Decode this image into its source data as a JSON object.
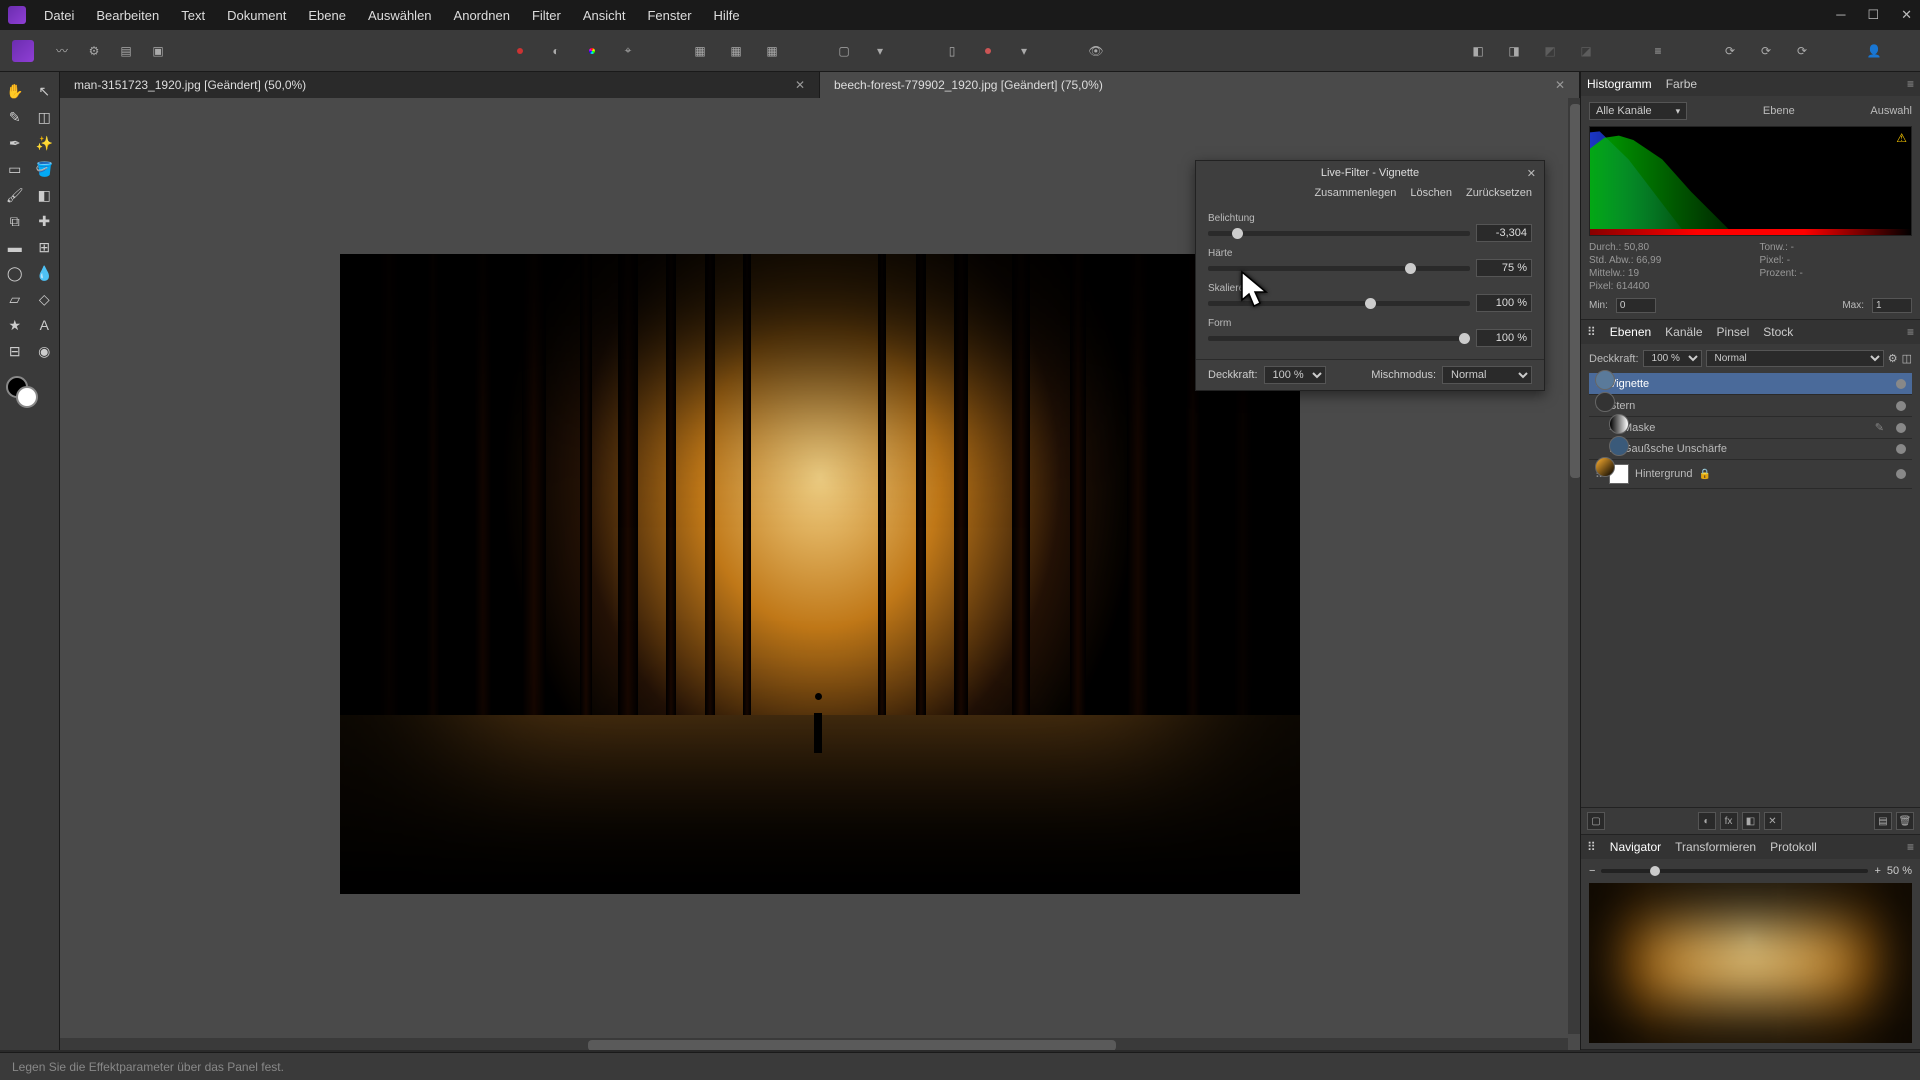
{
  "menubar": [
    "Datei",
    "Bearbeiten",
    "Text",
    "Dokument",
    "Ebene",
    "Auswählen",
    "Anordnen",
    "Filter",
    "Ansicht",
    "Fenster",
    "Hilfe"
  ],
  "tabs": [
    {
      "label": "man-3151723_1920.jpg [Geändert] (50,0%)",
      "active": false
    },
    {
      "label": "beech-forest-779902_1920.jpg [Geändert] (75,0%)",
      "active": true
    }
  ],
  "dialog": {
    "title": "Live-Filter - Vignette",
    "links": [
      "Zusammenlegen",
      "Löschen",
      "Zurücksetzen"
    ],
    "params": [
      {
        "label": "Belichtung",
        "value": "-3,304",
        "pos": 9
      },
      {
        "label": "Härte",
        "value": "75 %",
        "pos": 75
      },
      {
        "label": "Skalieren",
        "value": "100 %",
        "pos": 60
      },
      {
        "label": "Form",
        "value": "100 %",
        "pos": 100
      }
    ],
    "opacity_label": "Deckkraft:",
    "opacity": "100 %",
    "blend_label": "Mischmodus:",
    "blend": "Normal"
  },
  "histogram_panel": {
    "tabs": [
      "Histogramm",
      "Farbe"
    ],
    "channels": "Alle Kanäle",
    "chips": [
      "Ebene",
      "Auswahl"
    ],
    "stats": {
      "durch": "Durch.: 50,80",
      "tonw": "Tonw.: -",
      "stdabw": "Std. Abw.: 66,99",
      "pixel2": "Pixel: -",
      "mittelw": "Mittelw.: 19",
      "prozent": "Prozent: -",
      "pixel": "Pixel: 614400"
    },
    "min_label": "Min:",
    "min": "0",
    "max_label": "Max:",
    "max": "1"
  },
  "layers_panel": {
    "tabs": [
      "Ebenen",
      "Kanäle",
      "Pinsel",
      "Stock"
    ],
    "opacity_label": "Deckkraft:",
    "opacity": "100 %",
    "blend": "Normal",
    "layers": [
      {
        "name": "Vignette",
        "selected": true,
        "thumb": "fx"
      },
      {
        "name": "Stern",
        "thumb": "blank"
      },
      {
        "name": "Maske",
        "thumb": "mask",
        "indent": 1,
        "editable": true
      },
      {
        "name": "Gaußsche Unschärfe",
        "thumb": "fx",
        "indent": 1
      },
      {
        "name": "Hintergrund",
        "thumb": "img",
        "mask": true,
        "locked": true
      }
    ]
  },
  "navigator_panel": {
    "tabs": [
      "Navigator",
      "Transformieren",
      "Protokoll"
    ],
    "zoom": "50 %"
  },
  "statusbar": "Legen Sie die Effektparameter über das Panel fest."
}
